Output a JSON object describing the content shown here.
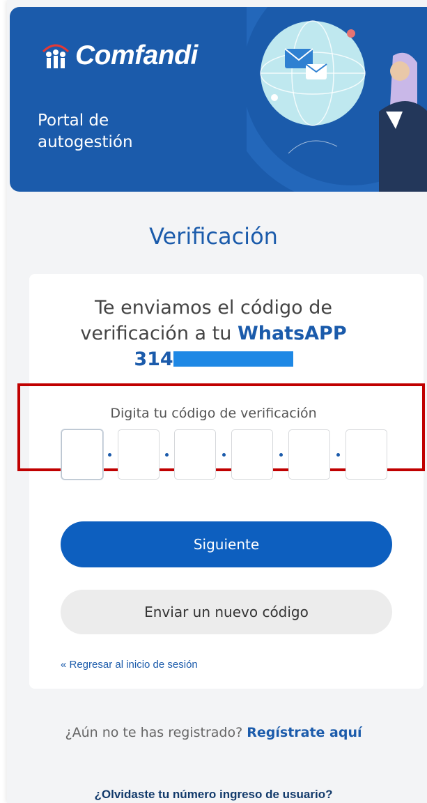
{
  "brand": {
    "name": "Comfandi"
  },
  "banner": {
    "subtitle_line1": "Portal de",
    "subtitle_line2": "autogestión"
  },
  "page": {
    "title": "Verificación"
  },
  "message": {
    "line1": "Te enviamos el código de",
    "line2_prefix": "verificación a tu ",
    "line2_channel": "WhatsAPP",
    "phone_visible": "314"
  },
  "code": {
    "label": "Digita tu código de verificación",
    "digits": [
      "",
      "",
      "",
      "",
      "",
      ""
    ]
  },
  "buttons": {
    "next": "Siguiente",
    "resend": "Enviar un nuevo código"
  },
  "links": {
    "back": "« Regresar al inicio de sesión",
    "register_prompt": "¿Aún no te has registrado?",
    "register_link": "Regístrate aquí",
    "forgot": "¿Olvidaste tu número ingreso de usuario?"
  },
  "colors": {
    "brand": "#1b5bab",
    "button": "#0d5fbf",
    "highlight": "#c00000"
  }
}
